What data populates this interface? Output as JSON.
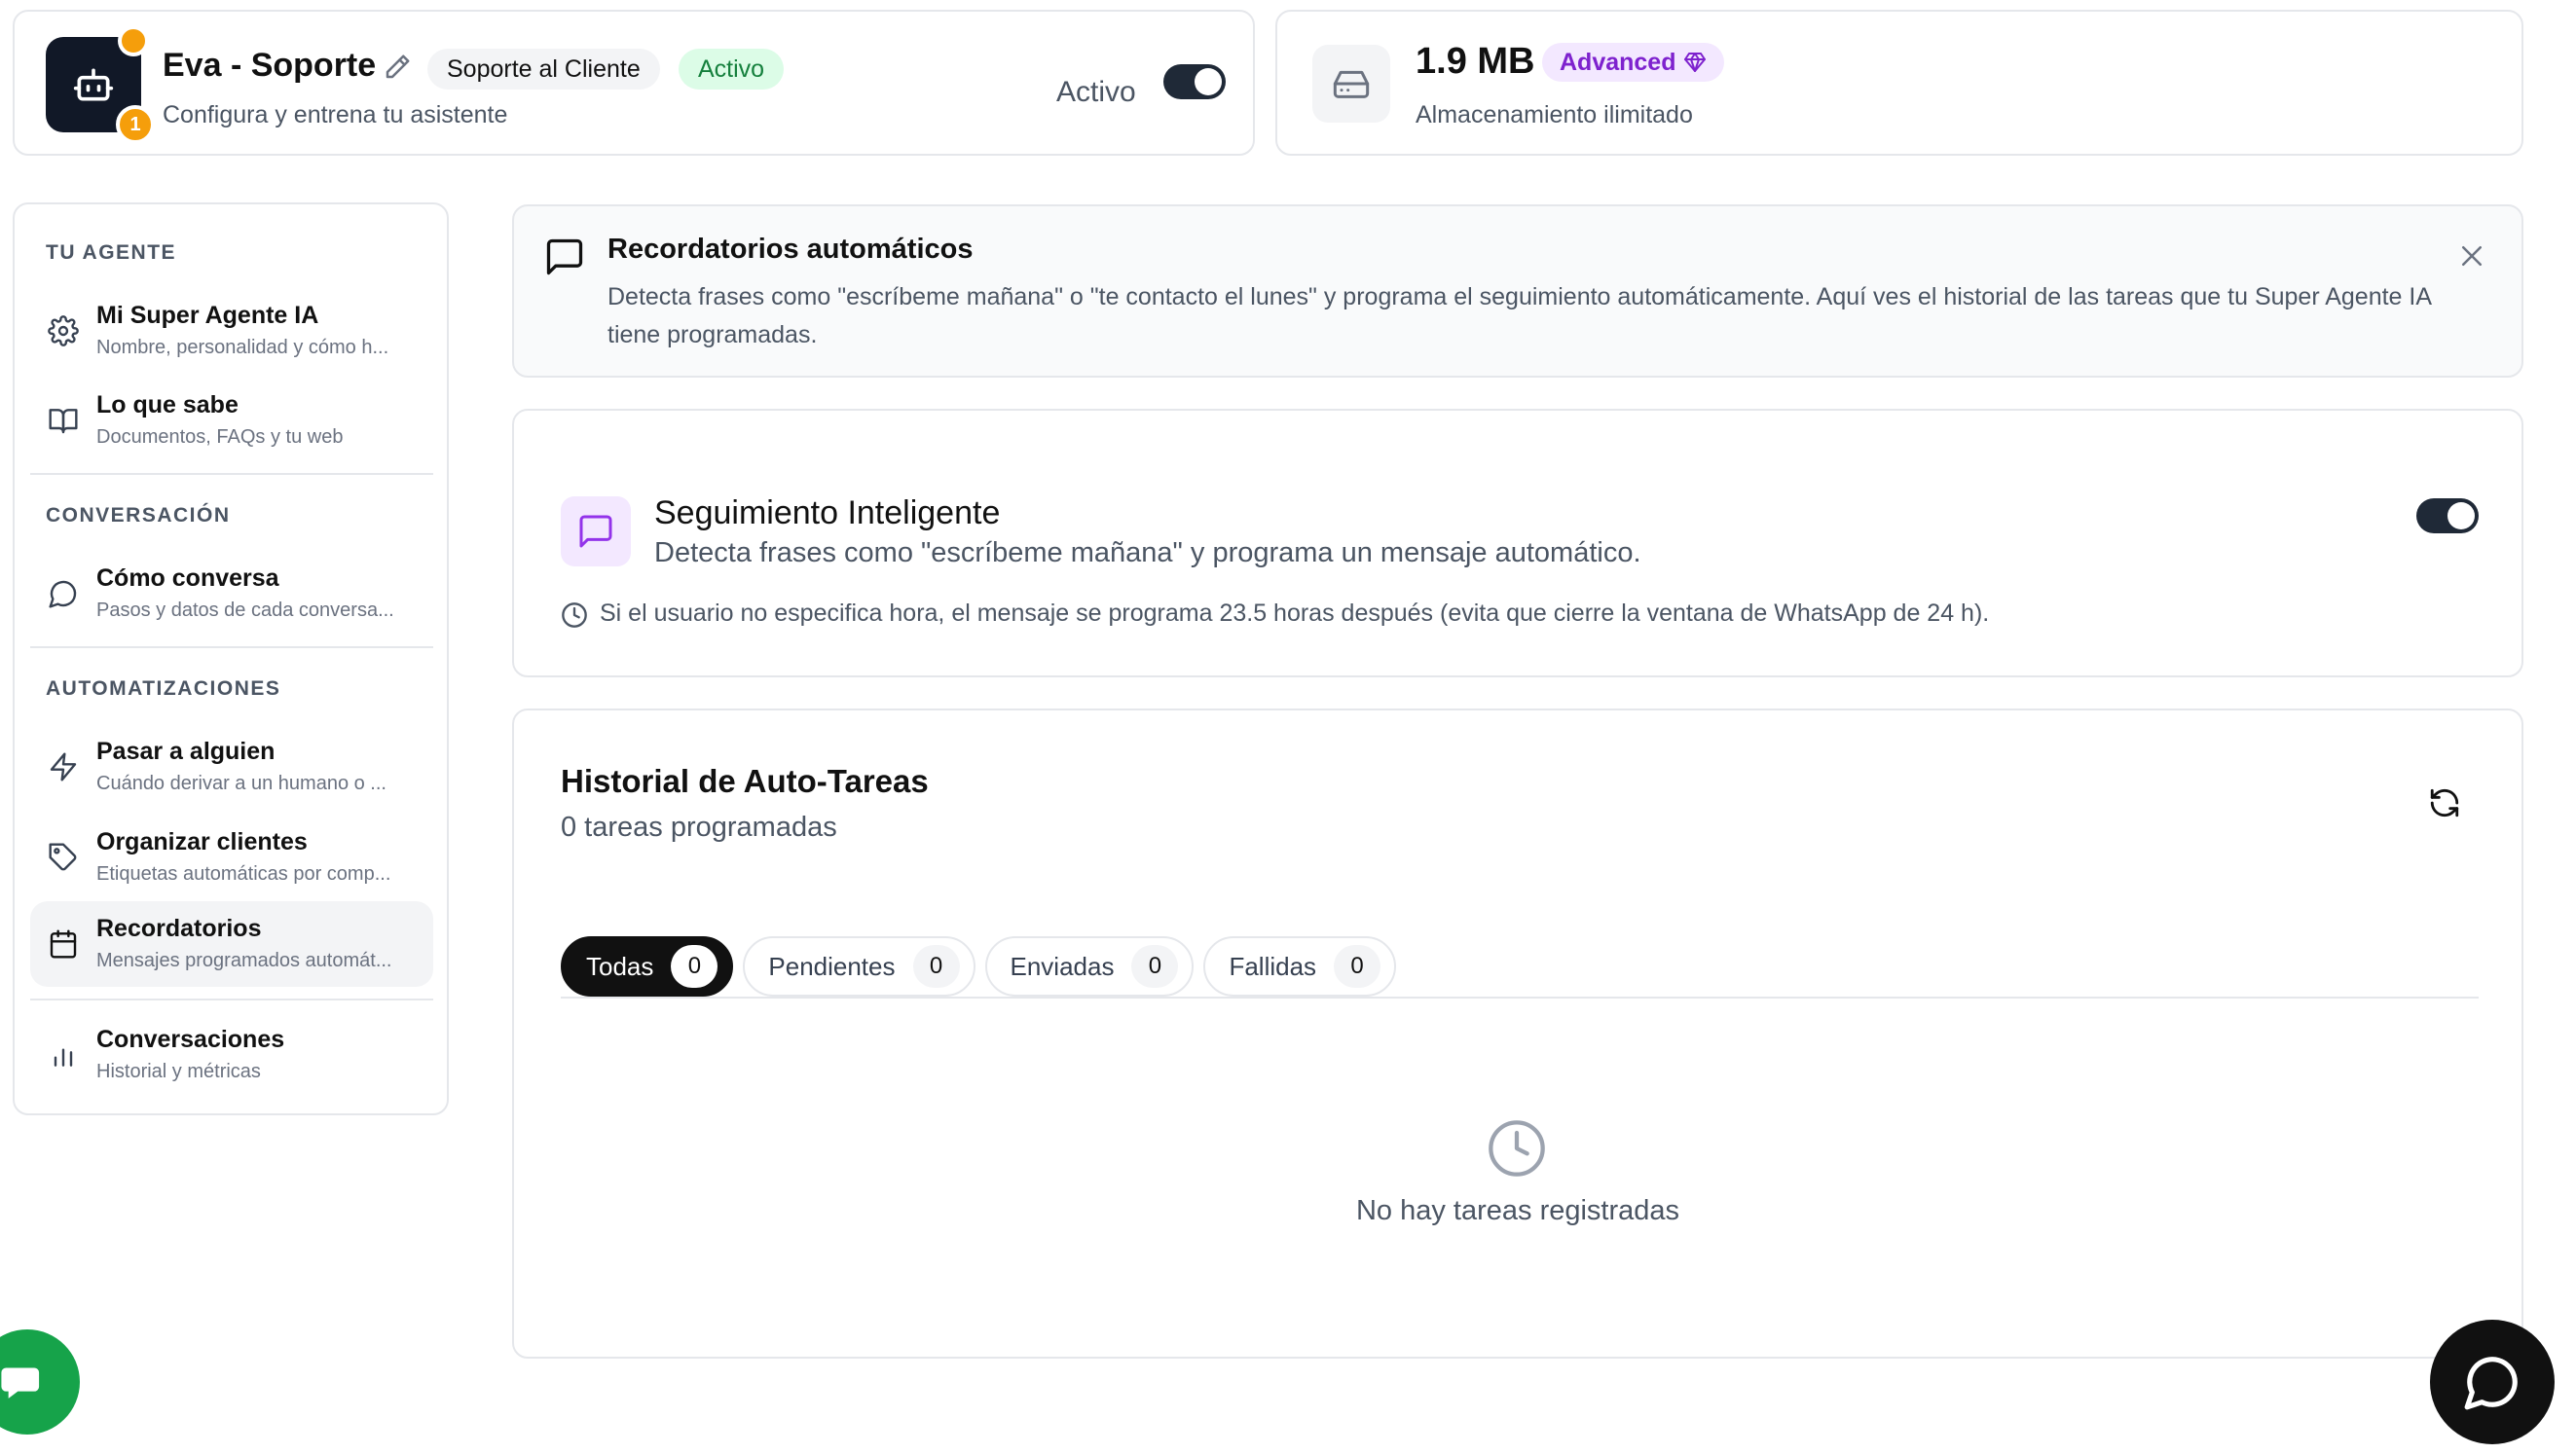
{
  "header": {
    "agent_name": "Eva - Soporte",
    "role_badge": "Soporte al Cliente",
    "status_badge": "Activo",
    "subtitle": "Configura y entrena tu asistente",
    "notification_count": "1",
    "status_label": "Activo",
    "status_on": true
  },
  "storage": {
    "size": "1.9 MB",
    "plan_badge": "Advanced",
    "description": "Almacenamiento ilimitado"
  },
  "sidebar": {
    "sections": [
      {
        "title": "TU AGENTE",
        "items": [
          {
            "label": "Mi Super Agente IA",
            "desc": "Nombre, personalidad y cómo h...",
            "icon": "gear-icon"
          },
          {
            "label": "Lo que sabe",
            "desc": "Documentos, FAQs y tu web",
            "icon": "book-icon"
          }
        ]
      },
      {
        "title": "CONVERSACIÓN",
        "items": [
          {
            "label": "Cómo conversa",
            "desc": "Pasos y datos de cada conversa...",
            "icon": "chat-bubble-icon"
          }
        ]
      },
      {
        "title": "AUTOMATIZACIONES",
        "items": [
          {
            "label": "Pasar a alguien",
            "desc": "Cuándo derivar a un humano o ...",
            "icon": "lightning-icon"
          },
          {
            "label": "Organizar clientes",
            "desc": "Etiquetas automáticas por comp...",
            "icon": "tag-icon"
          },
          {
            "label": "Recordatorios",
            "desc": "Mensajes programados automát...",
            "icon": "calendar-icon",
            "active": true
          }
        ]
      },
      {
        "title": "",
        "items": [
          {
            "label": "Conversaciones",
            "desc": "Historial y métricas",
            "icon": "bar-chart-icon"
          }
        ]
      }
    ]
  },
  "banner": {
    "title": "Recordatorios automáticos",
    "text": "Detecta frases como \"escríbeme mañana\" o \"te contacto el lunes\" y programa el seguimiento automáticamente. Aquí ves el historial de las tareas que tu Super Agente IA tiene programadas."
  },
  "smart_followup": {
    "title": "Seguimiento Inteligente",
    "description": "Detecta frases como \"escríbeme mañana\" y programa un mensaje automático.",
    "note": "Si el usuario no especifica hora, el mensaje se programa 23.5 horas después (evita que cierre la ventana de WhatsApp de 24 h).",
    "enabled": true
  },
  "history": {
    "title": "Historial de Auto-Tareas",
    "subtitle": "0 tareas programadas",
    "tabs": [
      {
        "label": "Todas",
        "count": "0",
        "active": true
      },
      {
        "label": "Pendientes",
        "count": "0"
      },
      {
        "label": "Enviadas",
        "count": "0"
      },
      {
        "label": "Fallidas",
        "count": "0"
      }
    ],
    "empty_text": "No hay tareas registradas"
  },
  "colors": {
    "accent_purple": "#7e22ce",
    "active_green": "#15803d",
    "warning_orange": "#f59e0b",
    "dark": "#111111"
  }
}
